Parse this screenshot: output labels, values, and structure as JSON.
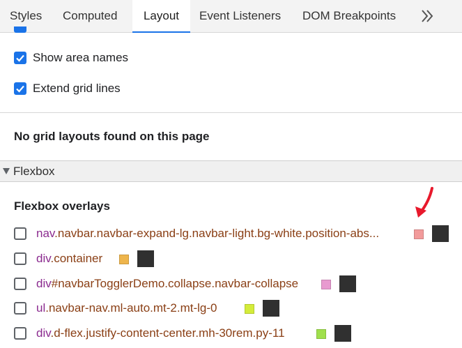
{
  "tabs": [
    {
      "label": "Styles"
    },
    {
      "label": "Computed"
    },
    {
      "label": "Layout"
    },
    {
      "label": "Event Listeners"
    },
    {
      "label": "DOM Breakpoints"
    }
  ],
  "active_tab": "Layout",
  "settings": {
    "show_area_names": {
      "label": "Show area names",
      "checked": true
    },
    "extend_grid_lines": {
      "label": "Extend grid lines",
      "checked": true
    }
  },
  "grid_message": "No grid layouts found on this page",
  "flexbox_section": {
    "title": "Flexbox",
    "overlays_title": "Flexbox overlays",
    "items": [
      {
        "tag": "nav",
        "rest": ".navbar.navbar-expand-lg.navbar-light.bg-white.position-abs...",
        "color": "#f29b9b",
        "checked": false
      },
      {
        "tag": "div",
        "rest": ".container",
        "color": "#eeb54c",
        "checked": false
      },
      {
        "tag": "div",
        "rest": "#navbarTogglerDemo.collapse.navbar-collapse",
        "color": "#e89ad0",
        "checked": false
      },
      {
        "tag": "ul",
        "rest": ".navbar-nav.ml-auto.mt-2.mt-lg-0",
        "color": "#d4ec3a",
        "checked": false
      },
      {
        "tag": "div",
        "rest": ".d-flex.justify-content-center.mh-30rem.py-11",
        "color": "#a0e04c",
        "checked": false
      }
    ]
  },
  "colors": {
    "accent": "#1a73e8",
    "annotation_arrow": "#e8192c"
  },
  "icons": {
    "more_tabs": "chevron-double-right-icon"
  }
}
